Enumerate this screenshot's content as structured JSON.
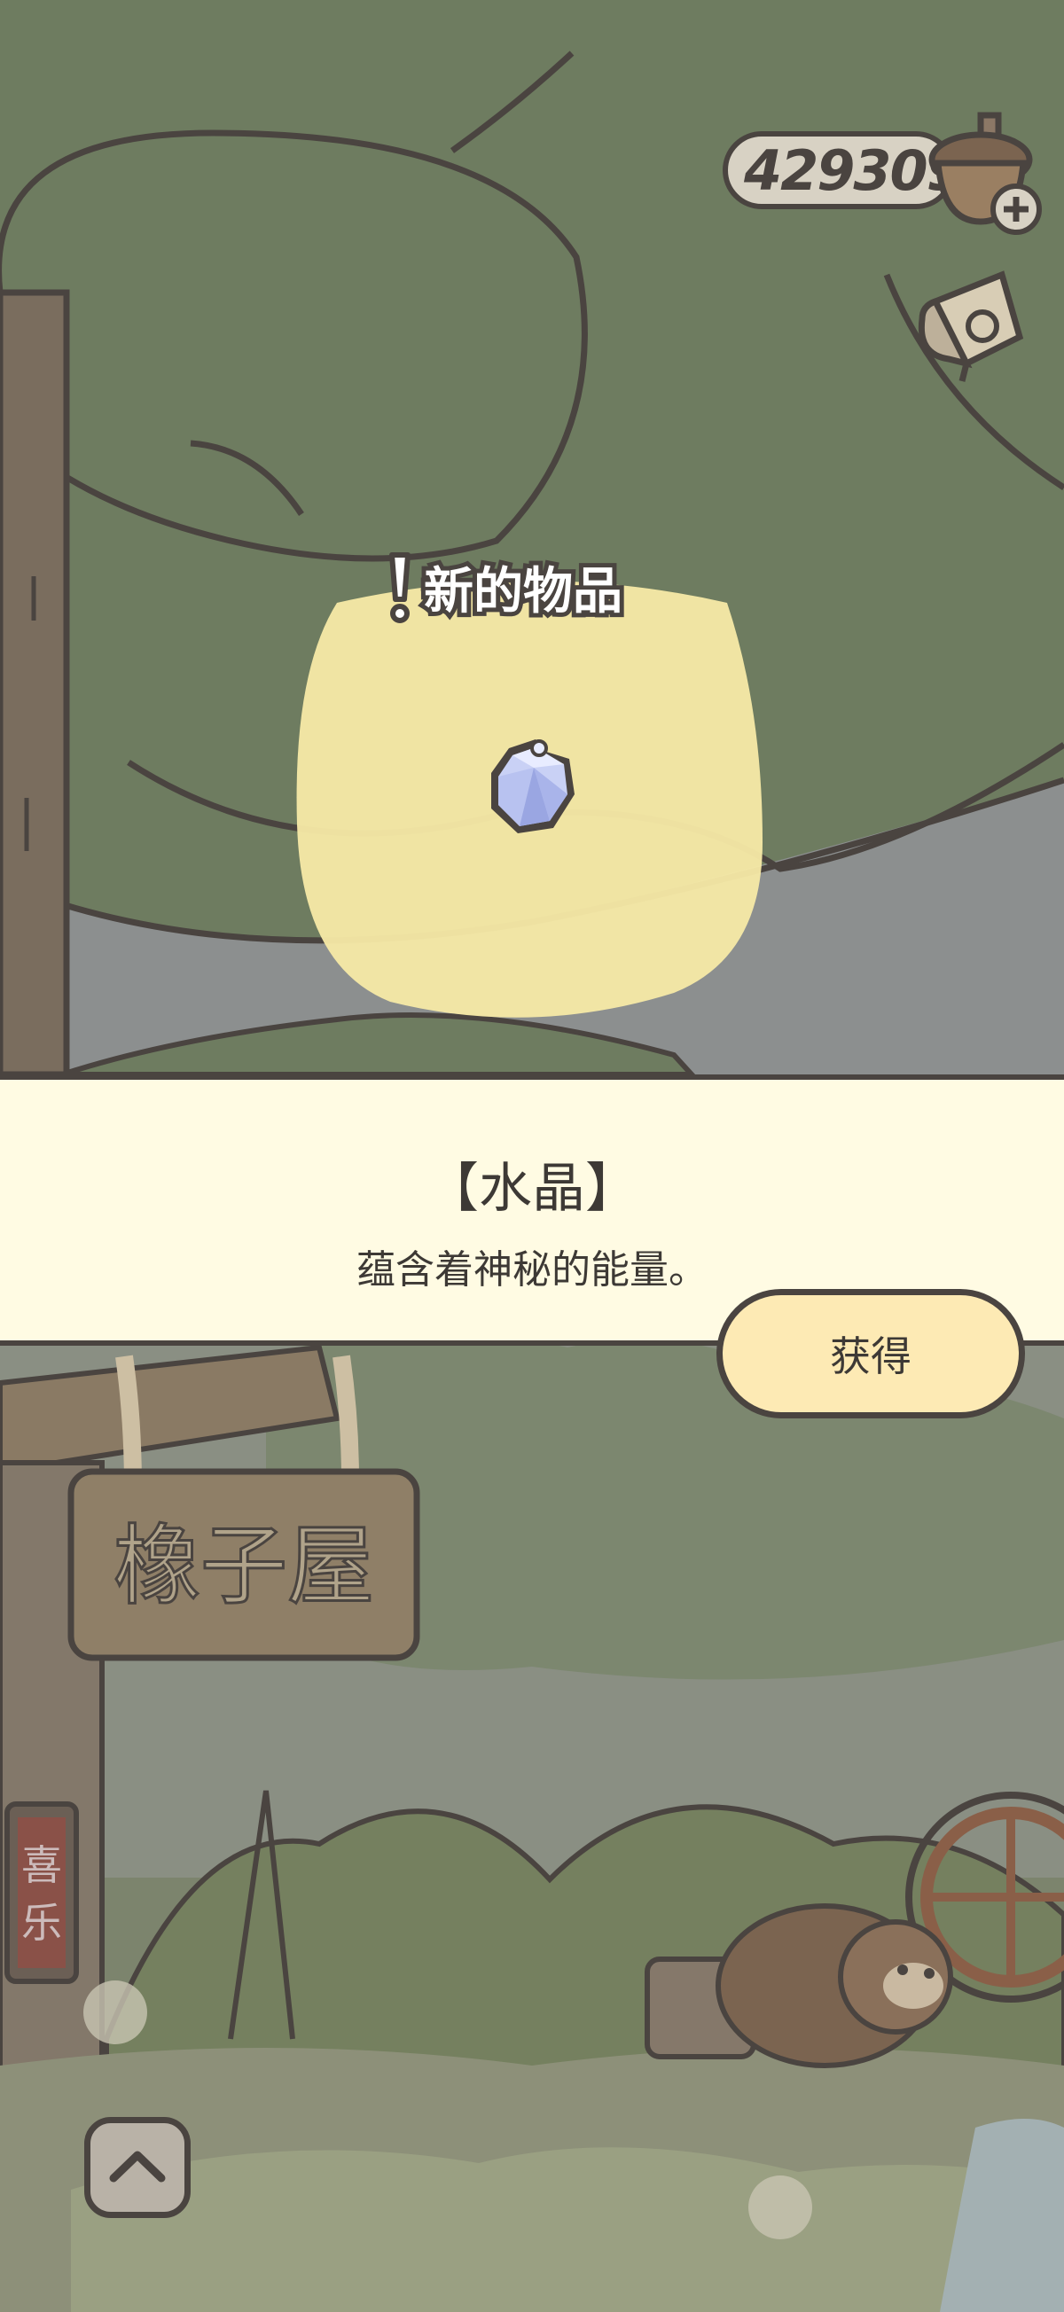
{
  "hud": {
    "acorn_count": "429309",
    "acorn_icon": "acorn-plus-icon",
    "note_icon": "note-scroll-icon"
  },
  "popup": {
    "new_item_label": "新的物品",
    "item_icon": "crystal-icon",
    "item_name": "【水晶】",
    "item_description": "蕴含着神秘的能量。",
    "get_button_label": "获得"
  },
  "scene": {
    "shop_sign": "橡子屋",
    "shop_banner": "喜乐",
    "scroll_up_icon": "chevron-up-icon"
  },
  "colors": {
    "outline": "#4a4440",
    "panel_bg": "#fffbe3",
    "button_bg": "#fdeab4",
    "highlight": "#f7eaa6",
    "foliage": "#6e7c60"
  }
}
